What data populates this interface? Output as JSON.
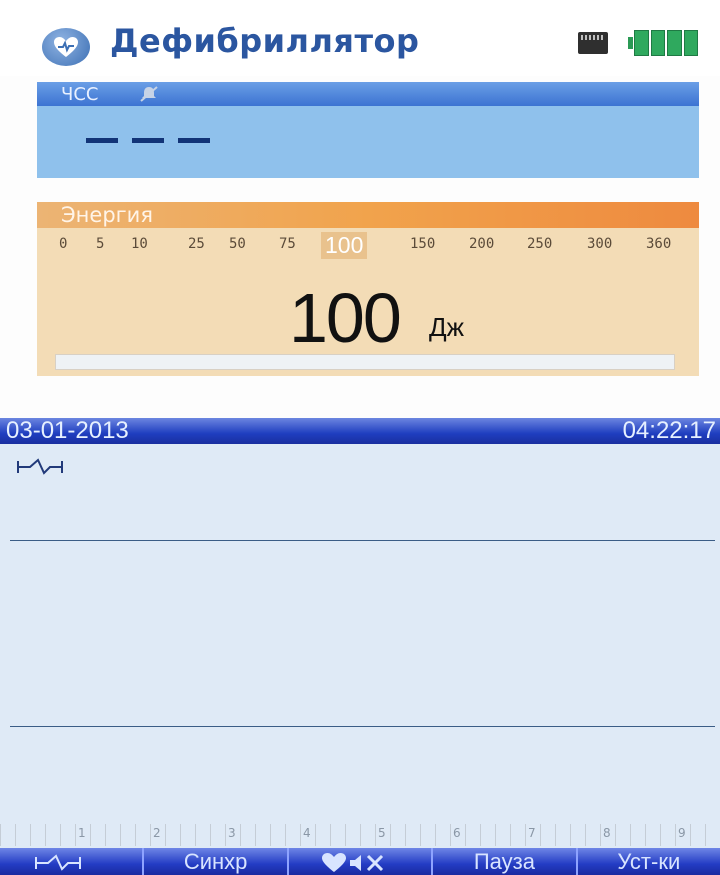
{
  "header": {
    "title": "Дефибриллятор",
    "app_icon": "heart-icon",
    "sd_icon": "sd-card-icon",
    "battery_icon": "battery-icon"
  },
  "hr": {
    "label": "ЧСС",
    "value": "———",
    "alarm_icon": "bell-muted-icon"
  },
  "energy": {
    "label": "Энергия",
    "scale": [
      "0",
      "5",
      "10",
      "25",
      "50",
      "75",
      "100",
      "150",
      "200",
      "250",
      "300",
      "360"
    ],
    "selected": "100",
    "value": "100",
    "unit": "Дж",
    "charge_progress": 0
  },
  "ecg": {
    "date": "03-01-2013",
    "time": "04:22:17",
    "lead_icon": "ecg-lead-icon",
    "time_scale": [
      "1",
      "2",
      "3",
      "4",
      "5",
      "6",
      "7",
      "8",
      "9"
    ]
  },
  "softkeys": [
    {
      "label": "",
      "icon": "ecg-lead-icon"
    },
    {
      "label": "Синхр"
    },
    {
      "label": "",
      "icon": "heart-mute-icon"
    },
    {
      "label": "Пауза"
    },
    {
      "label": "Уст-ки"
    }
  ],
  "colors": {
    "accent": "#2b56a0",
    "hr_panel": "#8fc1ec",
    "energy_panel": "#f3dcb6",
    "status_bar": "#1f3ec0"
  }
}
